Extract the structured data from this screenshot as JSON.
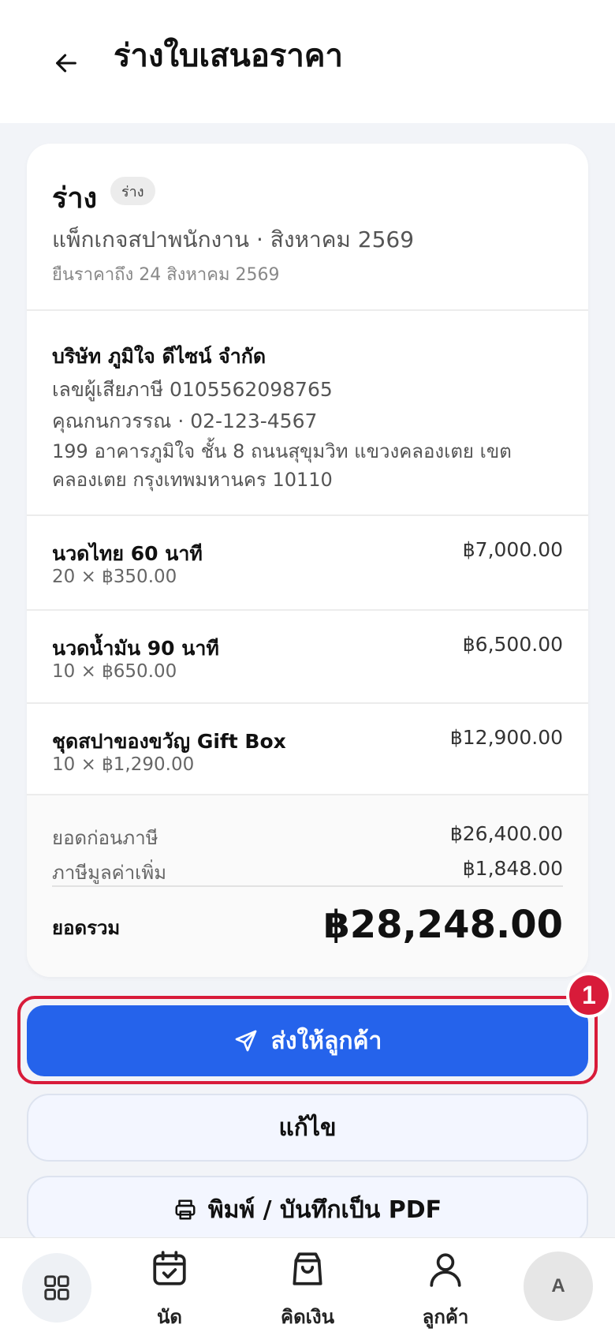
{
  "header": {
    "title": "ร่างใบเสนอราคา"
  },
  "quote": {
    "status": "ร่าง",
    "status_badge": "ร่าง",
    "subtitle": "แพ็กเกจสปาพนักงาน · สิงหาคม 2569",
    "valid_until": "ยืนราคาถึง 24 สิงหาคม 2569"
  },
  "customer": {
    "name": "บริษัท ภูมิใจ ดีไซน์ จำกัด",
    "tax_id": "เลขผู้เสียภาษี 0105562098765",
    "contact": "คุณกนกวรรณ · 02-123-4567",
    "address_line1": "199 อาคารภูมิใจ ชั้น 8 ถนนสุขุมวิท แขวงคลองเตย เขต",
    "address_line2": "คลองเตย กรุงเทพมหานคร 10110"
  },
  "items": [
    {
      "name": "นวดไทย 60 นาที",
      "qty": "20 × ฿350.00",
      "amount": "฿7,000.00"
    },
    {
      "name": "นวดน้ำมัน 90 นาที",
      "qty": "10 × ฿650.00",
      "amount": "฿6,500.00"
    },
    {
      "name": "ชุดสปาของขวัญ Gift Box",
      "qty": "10 × ฿1,290.00",
      "amount": "฿12,900.00"
    }
  ],
  "totals": {
    "subtotal_label": "ยอดก่อนภาษี",
    "subtotal": "฿26,400.00",
    "vat_label": "ภาษีมูลค่าเพิ่ม",
    "vat": "฿1,848.00",
    "grand_label": "ยอดรวม",
    "grand": "฿28,248.00"
  },
  "actions": {
    "send_label": "ส่งให้ลูกค้า",
    "edit_label": "แก้ไข",
    "print_label": "พิมพ์ / บันทึกเป็น PDF",
    "step_number": "1"
  },
  "nav": {
    "appointments": "นัด",
    "billing": "คิดเงิน",
    "customers": "ลูกค้า",
    "avatar_initial": "A"
  },
  "colors": {
    "primary": "#2563eb",
    "highlight": "#d81b3a"
  }
}
